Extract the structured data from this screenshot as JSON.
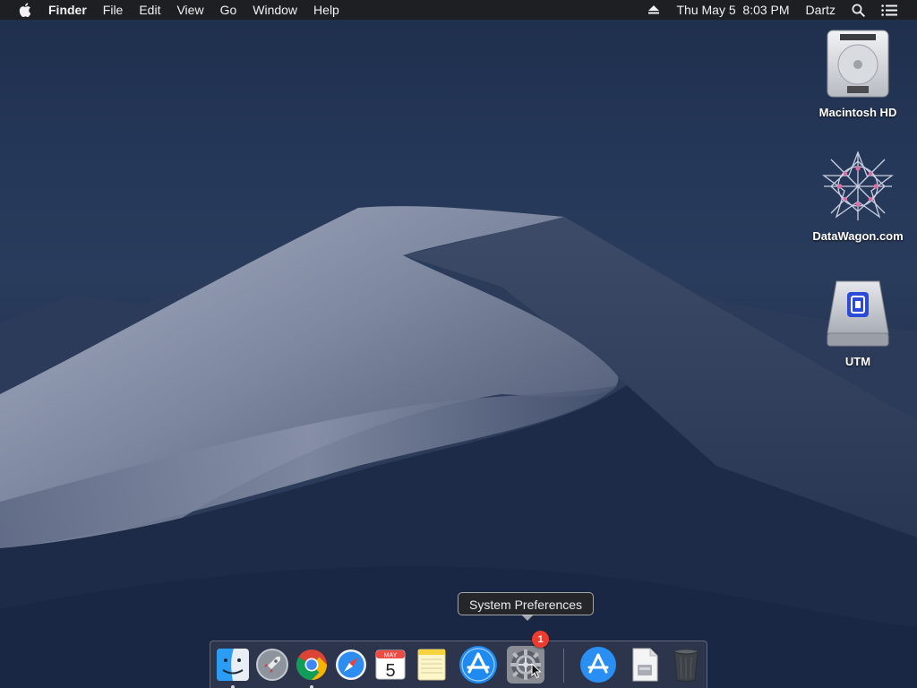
{
  "menubar": {
    "app_name": "Finder",
    "items": [
      "File",
      "Edit",
      "View",
      "Go",
      "Window",
      "Help"
    ],
    "datetime": "Thu May 5  8:03 PM",
    "user": "Dartz",
    "icons": [
      "apple-logo-icon",
      "eject-icon",
      "search-icon",
      "notification-center-icon"
    ]
  },
  "desktop": {
    "icons": [
      {
        "label": "Macintosh HD",
        "icon": "hard-drive-icon"
      },
      {
        "label": "DataWagon.com",
        "icon": "network-star-icon"
      },
      {
        "label": "UTM",
        "icon": "utm-drive-icon"
      }
    ]
  },
  "dock": {
    "tooltip": "System Preferences",
    "items": [
      {
        "name": "Finder",
        "icon": "finder-icon",
        "running": true
      },
      {
        "name": "Launchpad",
        "icon": "launchpad-rocket-icon",
        "running": false
      },
      {
        "name": "Google Chrome",
        "icon": "chrome-icon",
        "running": true
      },
      {
        "name": "Safari",
        "icon": "safari-compass-icon",
        "running": false
      },
      {
        "name": "Calendar",
        "icon": "calendar-icon",
        "running": false,
        "month": "MAY",
        "day": "5"
      },
      {
        "name": "Notes",
        "icon": "notes-icon",
        "running": false
      },
      {
        "name": "App Store",
        "icon": "app-store-icon",
        "running": false
      },
      {
        "name": "System Preferences",
        "icon": "gear-icon",
        "running": false,
        "badge": "1"
      },
      {
        "name": "App Store Downloads",
        "icon": "app-store-folder-icon",
        "running": false
      },
      {
        "name": "Document",
        "icon": "document-icon",
        "running": false
      },
      {
        "name": "Trash",
        "icon": "trash-icon",
        "running": false
      }
    ]
  },
  "colors": {
    "menubar_bg": "#1e1e20",
    "badge": "#ec3c30",
    "app_store_blue": "#1f8af0",
    "wallpaper_sky": "#253758"
  }
}
